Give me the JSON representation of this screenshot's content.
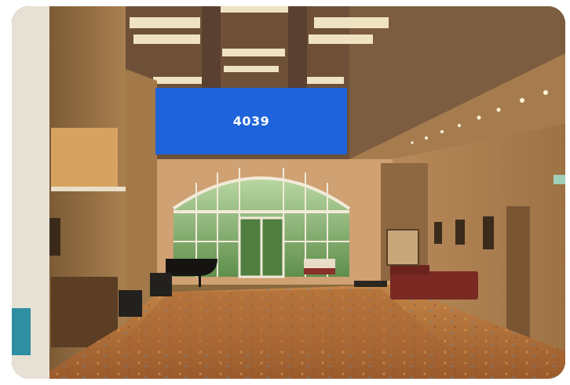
{
  "scene": {
    "display_screen": {
      "text": "4039",
      "background": "#1e63d9",
      "text_color": "#ffffff"
    },
    "palette": {
      "ceiling": "#6b5039",
      "ceiling_light": "#efe3c2",
      "wall_warm": "#c99a68",
      "wall_shadow": "#7a5a36",
      "left_pillar": "#e9e3d9",
      "window_green": "#6fa25a",
      "carpet": "#b8713a",
      "carpet_dark": "#8d5327",
      "sofa": "#7a2a22",
      "piano": "#161412"
    }
  }
}
